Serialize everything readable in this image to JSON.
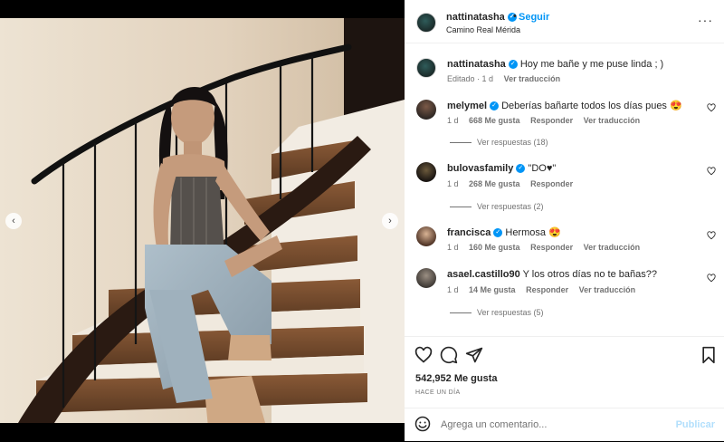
{
  "post": {
    "author": "nattinatasha",
    "follow_label": "Seguir",
    "separator": "•",
    "location": "Camino Real Mérida",
    "more_label": "···"
  },
  "caption": {
    "author": "nattinatasha",
    "text": "Hoy me bañe y me puse linda ; )",
    "edited": "Editado · 1 d",
    "translate": "Ver traducción"
  },
  "comments": [
    {
      "user": "melymel",
      "text": "Deberías bañarte todos los días pues 😍",
      "age": "1 d",
      "likes": "668 Me gusta",
      "reply": "Responder",
      "translate": "Ver traducción",
      "replies": "Ver respuestas (18)",
      "verified": true
    },
    {
      "user": "bulovasfamily",
      "text": "\"DO♥\"",
      "age": "1 d",
      "likes": "268 Me gusta",
      "reply": "Responder",
      "translate": "",
      "replies": "Ver respuestas (2)",
      "verified": true
    },
    {
      "user": "francisca",
      "text": "Hermosa 😍",
      "age": "1 d",
      "likes": "160 Me gusta",
      "reply": "Responder",
      "translate": "Ver traducción",
      "replies": "",
      "verified": true
    },
    {
      "user": "asael.castillo90",
      "text": "Y los otros días no te bañas??",
      "age": "1 d",
      "likes": "14 Me gusta",
      "reply": "Responder",
      "translate": "Ver traducción",
      "replies": "Ver respuestas (5)",
      "verified": false
    }
  ],
  "stats": {
    "likes": "542,952 Me gusta",
    "posted": "HACE UN DÍA"
  },
  "composer": {
    "placeholder": "Agrega un comentario...",
    "publish_label": "Publicar"
  },
  "carousel": {
    "prev_label": "‹",
    "next_label": "›",
    "slides": 4,
    "active_slide": 1
  },
  "colors": {
    "accent": "#0095f6",
    "like_heart": "#262626",
    "muted": "#737373"
  },
  "icons": [
    "verified-badge-icon",
    "more-options-icon",
    "heart-icon",
    "comment-icon",
    "share-icon",
    "bookmark-icon",
    "emoji-icon",
    "chevron-left-icon",
    "chevron-right-icon"
  ]
}
